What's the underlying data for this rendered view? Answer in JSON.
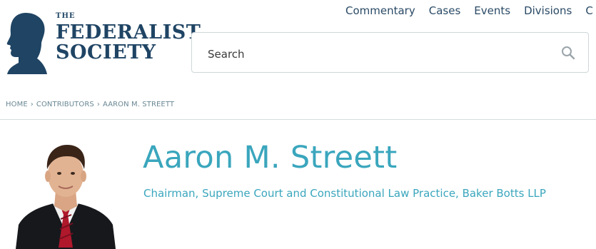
{
  "logo": {
    "the": "THE",
    "line1": "FEDERALIST",
    "line2": "SOCIETY"
  },
  "nav": {
    "items": [
      "Commentary",
      "Cases",
      "Events",
      "Divisions",
      "C"
    ]
  },
  "search": {
    "placeholder": "Search",
    "value": ""
  },
  "breadcrumb": {
    "home": "HOME",
    "contributors": "CONTRIBUTORS",
    "current": "AARON M. STREETT",
    "separator": "›"
  },
  "profile": {
    "name": "Aaron M. Streett",
    "title": "Chairman, Supreme Court and Constitutional Law Practice, Baker Botts LLP"
  },
  "colors": {
    "brand": "#1f4464",
    "accent": "#3aa6bd",
    "nav_text": "#2a4a66"
  },
  "icons": {
    "search": "search-icon",
    "logo": "silhouette-icon"
  }
}
